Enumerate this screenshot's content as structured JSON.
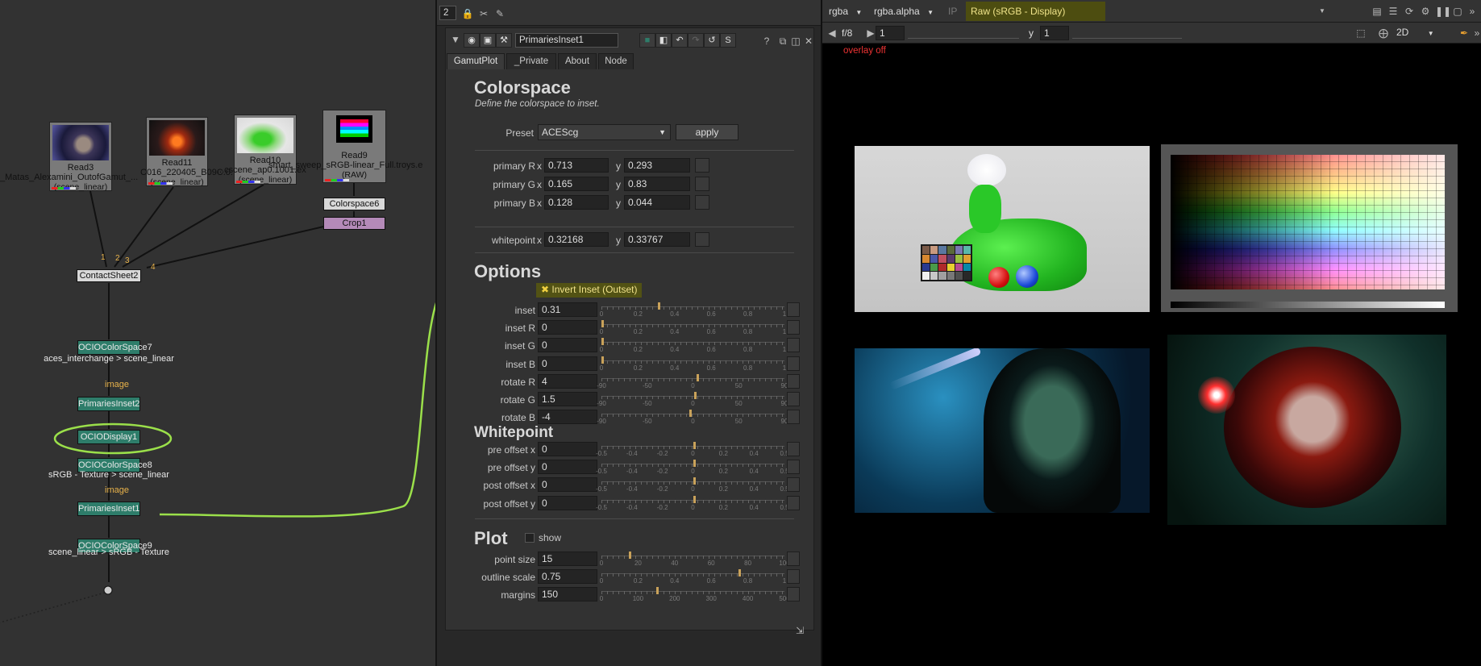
{
  "nodegraph": {
    "reads": [
      {
        "name": "Read3",
        "path": "_Matas_Alexamini_OutofGamut_...",
        "colorspace": "(scene_linear)"
      },
      {
        "name": "Read11",
        "path": "C016_220405_B09C.0...",
        "colorspace": "(scene_linear)"
      },
      {
        "name": "Read10",
        "path": "...cscene_ap0.1001.ex",
        "colorspace": "(scene_linear)"
      },
      {
        "name": "Read9",
        "path": "smart_sweep_sRGB-linear_Full.troys.e",
        "colorspace": "(RAW)"
      }
    ],
    "nodes": {
      "colorspace6": "Colorspace6",
      "crop1": "Crop1",
      "contactsheet": "ContactSheet2",
      "ocio7": "OCIOColorSpace7",
      "ocio7_label": "aces_interchange > scene_linear",
      "image_label": "image",
      "primaries2": "PrimariesInset2",
      "ociodisplay": "OCIODisplay1",
      "ocio8": "OCIOColorSpace8",
      "ocio8_label": "sRGB - Texture > scene_linear",
      "primaries1": "PrimariesInset1",
      "ocio9": "OCIOColorSpace9",
      "ocio9_label": "scene_linear > sRGB - Texture"
    },
    "input_numbers": [
      "1",
      "2",
      "3",
      "4"
    ]
  },
  "properties": {
    "toolbar_count": "2",
    "node_name": "PrimariesInset1",
    "tabs": [
      "GamutPlot",
      "_Private",
      "About",
      "Node"
    ],
    "active_tab": "GamutPlot",
    "colorspace": {
      "title": "Colorspace",
      "desc": "Define the colorspace to inset.",
      "preset_label": "Preset",
      "preset_value": "ACEScg",
      "apply_label": "apply",
      "primaries": [
        {
          "label": "primary R",
          "x": "0.713",
          "y": "0.293"
        },
        {
          "label": "primary G",
          "x": "0.165",
          "y": "0.83"
        },
        {
          "label": "primary B",
          "x": "0.128",
          "y": "0.044"
        }
      ],
      "whitepoint": {
        "label": "whitepoint",
        "x": "0.32168",
        "y": "0.33767"
      }
    },
    "options": {
      "title": "Options",
      "invert_label": "Invert Inset (Outset)",
      "sliders": [
        {
          "label": "inset",
          "value": "0.31",
          "handle": 0.31,
          "scale": [
            "0",
            "0.2",
            "0.4",
            "0.6",
            "0.8",
            "1"
          ]
        },
        {
          "label": "inset R",
          "value": "0",
          "handle": 0,
          "scale": [
            "0",
            "0.2",
            "0.4",
            "0.6",
            "0.8",
            "1"
          ]
        },
        {
          "label": "inset G",
          "value": "0",
          "handle": 0,
          "scale": [
            "0",
            "0.2",
            "0.4",
            "0.6",
            "0.8",
            "1"
          ]
        },
        {
          "label": "inset B",
          "value": "0",
          "handle": 0,
          "scale": [
            "0",
            "0.2",
            "0.4",
            "0.6",
            "0.8",
            "1"
          ]
        },
        {
          "label": "rotate R",
          "value": "4",
          "handle": 0.522,
          "scale": [
            "-90",
            "-50",
            "0",
            "50",
            "90"
          ]
        },
        {
          "label": "rotate G",
          "value": "1.5",
          "handle": 0.508,
          "scale": [
            "-90",
            "-50",
            "0",
            "50",
            "90"
          ]
        },
        {
          "label": "rotate B",
          "value": "-4",
          "handle": 0.478,
          "scale": [
            "-90",
            "-50",
            "0",
            "50",
            "90"
          ]
        }
      ]
    },
    "whitepoint": {
      "title": "Whitepoint",
      "sliders": [
        {
          "label": "pre offset x",
          "value": "0",
          "handle": 0.5,
          "scale": [
            "-0.5",
            "-0.4",
            "-0.2",
            "0",
            "0.2",
            "0.4",
            "0.5"
          ]
        },
        {
          "label": "pre offset y",
          "value": "0",
          "handle": 0.5,
          "scale": [
            "-0.5",
            "-0.4",
            "-0.2",
            "0",
            "0.2",
            "0.4",
            "0.5"
          ]
        },
        {
          "label": "post offset x",
          "value": "0",
          "handle": 0.5,
          "scale": [
            "-0.5",
            "-0.4",
            "-0.2",
            "0",
            "0.2",
            "0.4",
            "0.5"
          ]
        },
        {
          "label": "post offset y",
          "value": "0",
          "handle": 0.5,
          "scale": [
            "-0.5",
            "-0.4",
            "-0.2",
            "0",
            "0.2",
            "0.4",
            "0.5"
          ]
        }
      ]
    },
    "plot": {
      "title": "Plot",
      "show_label": "show",
      "sliders": [
        {
          "label": "point size",
          "value": "15",
          "handle": 0.15,
          "scale": [
            "0",
            "20",
            "40",
            "60",
            "80",
            "100"
          ]
        },
        {
          "label": "outline scale",
          "value": "0.75",
          "handle": 0.75,
          "scale": [
            "0",
            "0.2",
            "0.4",
            "0.6",
            "0.8",
            "1"
          ]
        },
        {
          "label": "margins",
          "value": "150",
          "handle": 0.3,
          "scale": [
            "0",
            "100",
            "200",
            "300",
            "400",
            "500"
          ]
        }
      ]
    }
  },
  "viewer": {
    "channels": "rgba",
    "alpha": "rgba.alpha",
    "ip": "IP",
    "display": "Raw (sRGB - Display)",
    "fstop": "f/8",
    "frame": "1",
    "y_label": "y",
    "y_value": "1",
    "view_mode": "2D",
    "overlay": "overlay off"
  },
  "colors": {
    "annotation_green": "#9be04a",
    "node_teal": "#2e7d6a",
    "highlight_yellow": "#525214"
  }
}
